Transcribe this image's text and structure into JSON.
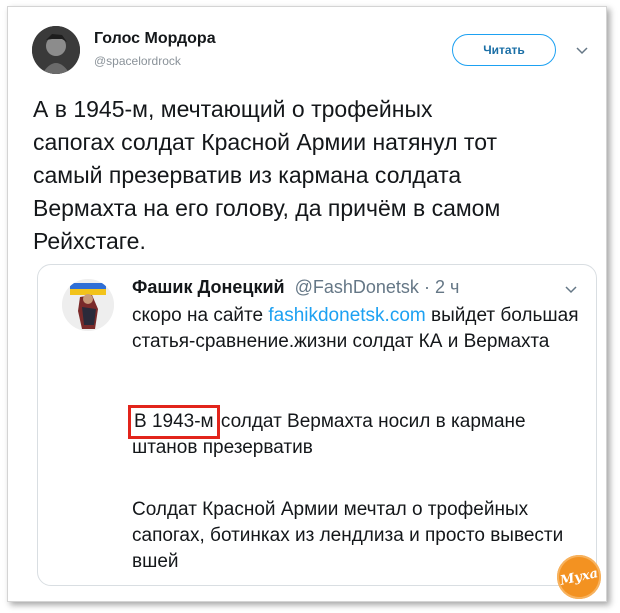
{
  "author": {
    "name": "Голос Мордора",
    "handle": "@spacelordrock"
  },
  "actions": {
    "follow_label": "Читать"
  },
  "tweet": {
    "text": "А в 1945-м, мечтающий о трофейных\nсапогах солдат Красной Армии натянул тот\nсамый презерватив из кармана солдата\nВермахта на его голову, да причём в самом\nРейхстаге."
  },
  "quoted_tweet": {
    "name": "Фашик Донецкий",
    "handle": "@FashDonetsk",
    "separator": " · ",
    "time": "2 ч",
    "p1_before": "скоро на сайте ",
    "p1_link": "fashikdonetsk.com",
    "p1_after": " выйдет большая статья-сравнение.жизни солдат КА и Вермахта",
    "p2_highlight": "В 1943-м",
    "p2_rest": " солдат Вермахта носил в кармане штанов презерватив",
    "p3": "Солдат Красной Армии мечтал о трофейных сапогах, ботинках из лендлиза и просто вывести вшей"
  },
  "watermark": {
    "text": "Муха"
  },
  "colors": {
    "accent": "#1da1f2",
    "highlight_box": "#e2241b",
    "watermark": "#f39221"
  },
  "icons": {
    "menu": "chevron-down-icon"
  }
}
